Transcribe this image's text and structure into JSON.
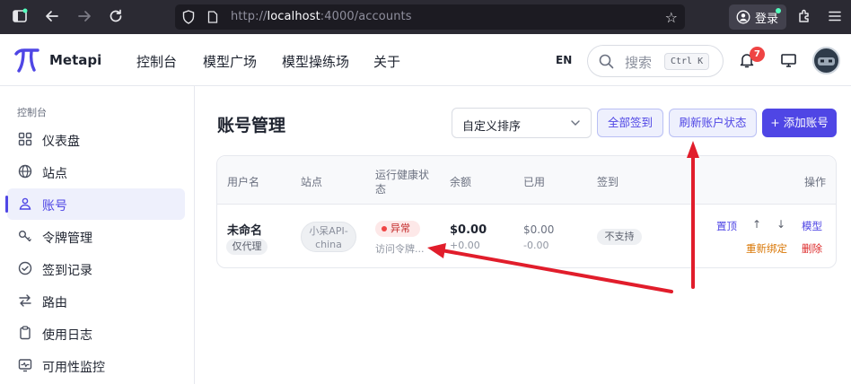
{
  "browser": {
    "url_prefix": "http://",
    "url_host": "localhost",
    "url_path": ":4000/accounts",
    "login_label": "登录"
  },
  "app": {
    "brand": "Metapi",
    "nav": [
      "控制台",
      "模型广场",
      "模型操练场",
      "关于"
    ],
    "lang": "EN",
    "search_placeholder": "搜索",
    "search_shortcut": "Ctrl K",
    "notification_count": "7"
  },
  "sidebar": {
    "section": "控制台",
    "items": [
      {
        "label": "仪表盘",
        "icon": "grid-icon"
      },
      {
        "label": "站点",
        "icon": "globe-icon"
      },
      {
        "label": "账号",
        "icon": "users-icon",
        "active": true
      },
      {
        "label": "令牌管理",
        "icon": "key-icon"
      },
      {
        "label": "签到记录",
        "icon": "check-circle-icon"
      },
      {
        "label": "路由",
        "icon": "route-icon"
      },
      {
        "label": "使用日志",
        "icon": "clipboard-icon"
      },
      {
        "label": "可用性监控",
        "icon": "monitor-pulse-icon"
      }
    ]
  },
  "main": {
    "title": "账号管理",
    "sort_select": "自定义排序",
    "buttons": {
      "checkin_all": "全部签到",
      "refresh_status": "刷新账户状态",
      "add_account": "+ 添加账号"
    },
    "table": {
      "headers": {
        "username": "用户名",
        "site": "站点",
        "health_1": "运行健康状",
        "health_2": "态",
        "balance": "余额",
        "used": "已用",
        "checkin": "签到",
        "actions": "操作"
      },
      "rows": [
        {
          "name": "未命名",
          "tag": "仅代理",
          "site_1": "小呆API-",
          "site_2": "china",
          "health": "异常",
          "health_detail": "访问令牌...",
          "balance": "$0.00",
          "balance_delta": "+0.00",
          "used": "$0.00",
          "used_delta": "-0.00",
          "checkin": "不支持",
          "actions": {
            "pin": "置顶",
            "up": "↑",
            "down": "↓",
            "model": "模型",
            "rebind": "重新绑定",
            "delete": "删除"
          }
        }
      ]
    }
  },
  "colors": {
    "accent": "#4f46e5",
    "annotation_arrow": "#e11d2b"
  }
}
